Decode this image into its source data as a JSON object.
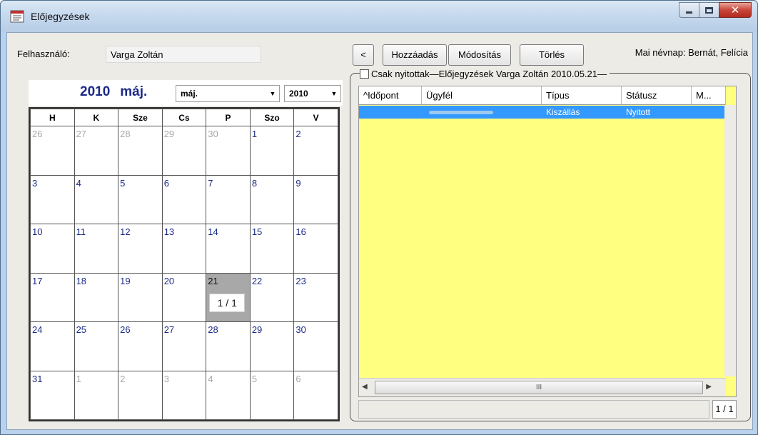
{
  "window": {
    "title": "Előjegyzések"
  },
  "user": {
    "label": "Felhasználó:",
    "value": "Varga Zoltán"
  },
  "calendar": {
    "year": "2010",
    "month_short": "máj.",
    "month_select": "máj.",
    "year_select": "2010",
    "weekdays": [
      "H",
      "K",
      "Sze",
      "Cs",
      "P",
      "Szo",
      "V"
    ],
    "selected_badge": "1 / 1",
    "weeks": [
      [
        {
          "d": "26",
          "m": "other"
        },
        {
          "d": "27",
          "m": "other"
        },
        {
          "d": "28",
          "m": "other"
        },
        {
          "d": "29",
          "m": "other"
        },
        {
          "d": "30",
          "m": "other"
        },
        {
          "d": "1",
          "m": "cur"
        },
        {
          "d": "2",
          "m": "cur"
        }
      ],
      [
        {
          "d": "3",
          "m": "cur"
        },
        {
          "d": "4",
          "m": "cur"
        },
        {
          "d": "5",
          "m": "cur"
        },
        {
          "d": "6",
          "m": "cur"
        },
        {
          "d": "7",
          "m": "cur"
        },
        {
          "d": "8",
          "m": "cur"
        },
        {
          "d": "9",
          "m": "cur"
        }
      ],
      [
        {
          "d": "10",
          "m": "cur"
        },
        {
          "d": "11",
          "m": "cur"
        },
        {
          "d": "12",
          "m": "cur"
        },
        {
          "d": "13",
          "m": "cur"
        },
        {
          "d": "14",
          "m": "cur"
        },
        {
          "d": "15",
          "m": "cur"
        },
        {
          "d": "16",
          "m": "cur"
        }
      ],
      [
        {
          "d": "17",
          "m": "cur"
        },
        {
          "d": "18",
          "m": "cur"
        },
        {
          "d": "19",
          "m": "cur"
        },
        {
          "d": "20",
          "m": "cur"
        },
        {
          "d": "21",
          "m": "sel"
        },
        {
          "d": "22",
          "m": "cur"
        },
        {
          "d": "23",
          "m": "cur"
        }
      ],
      [
        {
          "d": "24",
          "m": "cur"
        },
        {
          "d": "25",
          "m": "cur"
        },
        {
          "d": "26",
          "m": "cur"
        },
        {
          "d": "27",
          "m": "cur"
        },
        {
          "d": "28",
          "m": "cur"
        },
        {
          "d": "29",
          "m": "cur"
        },
        {
          "d": "30",
          "m": "cur"
        }
      ],
      [
        {
          "d": "31",
          "m": "cur"
        },
        {
          "d": "1",
          "m": "other"
        },
        {
          "d": "2",
          "m": "other"
        },
        {
          "d": "3",
          "m": "other"
        },
        {
          "d": "4",
          "m": "other"
        },
        {
          "d": "5",
          "m": "other"
        },
        {
          "d": "6",
          "m": "other"
        }
      ]
    ]
  },
  "toolbar": {
    "back_label": "<",
    "add_label": "Hozzáadás",
    "modify_label": "Módosítás",
    "delete_label": "Törlés"
  },
  "nameday": "Mai névnap: Bernát, Felícia",
  "group": {
    "only_open_label": "Csak nyitottak",
    "caption": "Előjegyzések Varga Zoltán 2010.05.21"
  },
  "table": {
    "columns": [
      "^Időpont",
      "Ügyfél",
      "Típus",
      "Státusz",
      "M..."
    ],
    "rows": [
      {
        "idopont": "",
        "ugyfel": "",
        "tipus": "Kiszállás",
        "statusz": "Nyitott",
        "m": ""
      }
    ],
    "hscroll_label": "III",
    "page_counter": "1 / 1"
  },
  "colors": {
    "grid_background": "#ffff80",
    "selected_row": "#3399ff",
    "calendar_date": "#1a2a86",
    "selected_day": "#a8a8a8"
  }
}
